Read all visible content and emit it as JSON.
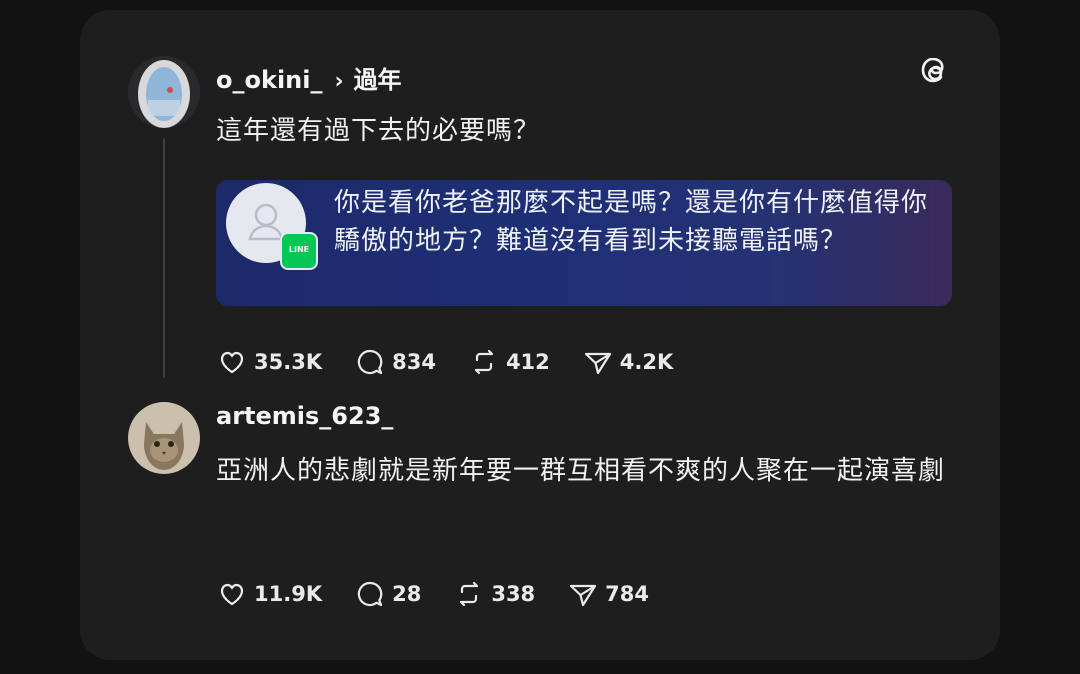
{
  "posts": [
    {
      "username": "o_okini_",
      "topic": "過年",
      "text": "這年還有過下去的必要嗎？",
      "embed": {
        "app_badge": "LINE",
        "message": "你是看你老爸那麼不起是嗎？還是你有什麼值得你驕傲的地方？難道沒有看到未接聽電話嗎？"
      },
      "stats": {
        "likes": "35.3K",
        "replies": "834",
        "reposts": "412",
        "shares": "4.2K"
      }
    },
    {
      "username": "artemis_623_",
      "text": "亞洲人的悲劇就是新年要一群互相看不爽的人聚在一起演喜劇",
      "stats": {
        "likes": "11.9K",
        "replies": "28",
        "reposts": "338",
        "shares": "784"
      }
    }
  ],
  "colors": {
    "line_green": "#06c755",
    "card_bg": "#1e1e1e"
  },
  "icons": [
    "threads-logo-icon",
    "heart-icon",
    "reply-icon",
    "repost-icon",
    "share-icon",
    "person-icon"
  ]
}
